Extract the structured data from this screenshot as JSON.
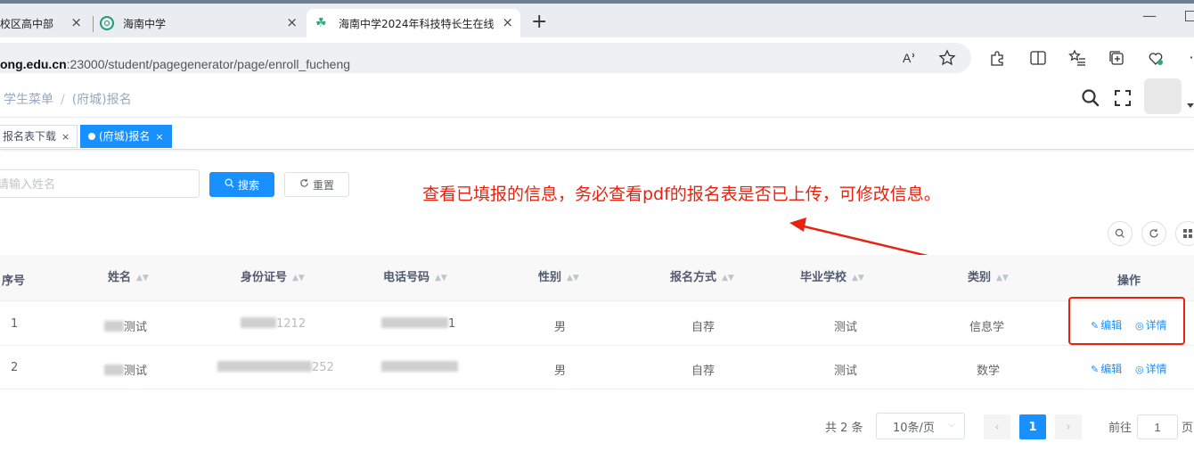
{
  "browser": {
    "tabs": [
      {
        "label": "校区高中部",
        "active": false
      },
      {
        "label": "海南中学",
        "active": false
      },
      {
        "label": "海南中学2024年科技特长生在线",
        "active": true
      }
    ],
    "new_tab": "+",
    "address": {
      "host": "ong.edu.cn",
      "rest": ":23000/student/pagegenerator/page/enroll_fucheng"
    },
    "read_aloud": "Á"
  },
  "header": {
    "breadcrumb": [
      "学生菜单",
      "(府城)报名"
    ]
  },
  "tags": [
    {
      "label": "报名表下载",
      "active": false
    },
    {
      "label": "(府城)报名",
      "active": true
    }
  ],
  "search": {
    "placeholder": "请输入姓名",
    "search_label": "搜索",
    "reset_label": "重置"
  },
  "annotation": {
    "text": "查看已填报的信息，务必查看pdf的报名表是否已上传，可修改信息。",
    "color": "#e8220f"
  },
  "table": {
    "columns": [
      "序号",
      "姓名",
      "身份证号",
      "电话号码",
      "性别",
      "报名方式",
      "毕业学校",
      "类别",
      "操作"
    ],
    "rows": [
      {
        "index": "1",
        "name": "测试",
        "id_tail": "1212",
        "phone_tail": "1",
        "gender": "男",
        "method": "自荐",
        "school": "测试",
        "category": "信息学"
      },
      {
        "index": "2",
        "name": "测试",
        "id_tail": "252",
        "phone_tail": "",
        "gender": "男",
        "method": "自荐",
        "school": "测试",
        "category": "数学"
      }
    ],
    "actions": {
      "edit": "编辑",
      "detail": "详情"
    }
  },
  "pagination": {
    "total": "共 2 条",
    "page_size": "10条/页",
    "current_page": "1",
    "goto_label": "前往",
    "goto_value": "1",
    "page_suffix": "页"
  },
  "colors": {
    "primary": "#1890ff",
    "annotation": "#e8220f"
  }
}
